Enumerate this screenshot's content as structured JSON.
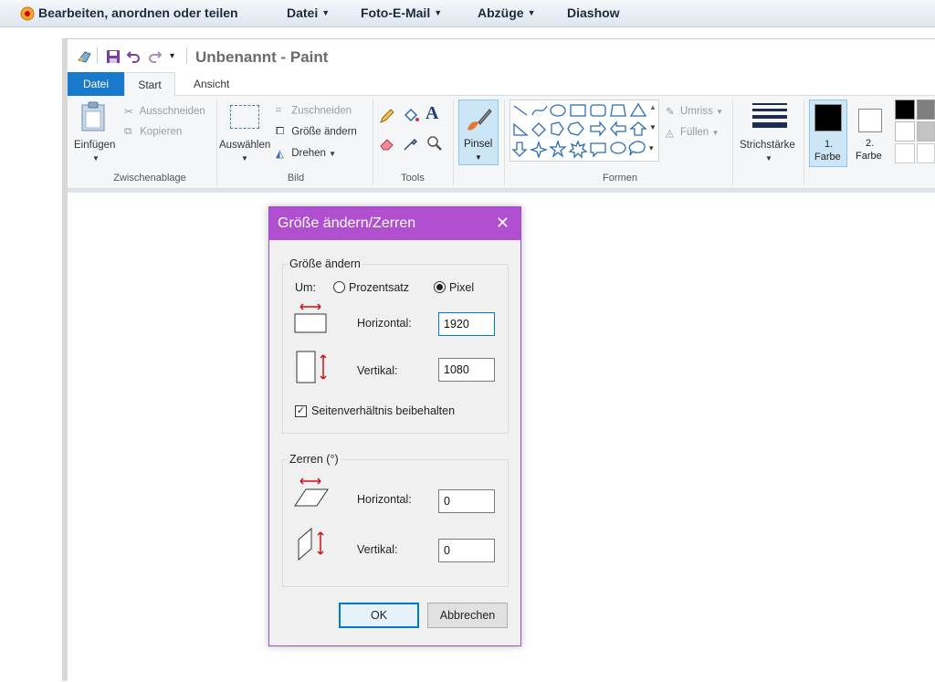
{
  "topbar": {
    "items": [
      {
        "label": "Bearbeiten, anordnen oder teilen",
        "caret": false
      },
      {
        "label": "Datei",
        "caret": true
      },
      {
        "label": "Foto-E-Mail",
        "caret": true
      },
      {
        "label": "Abzüge",
        "caret": true
      },
      {
        "label": "Diashow",
        "caret": false
      }
    ]
  },
  "window": {
    "title": "Unbenannt - Paint"
  },
  "tabs": {
    "file": "Datei",
    "start": "Start",
    "view": "Ansicht"
  },
  "ribbon": {
    "clipboard": {
      "paste": "Einfügen",
      "cut": "Ausschneiden",
      "copy": "Kopieren",
      "label": "Zwischenablage"
    },
    "image": {
      "select": "Auswählen",
      "crop": "Zuschneiden",
      "resize": "Größe ändern",
      "rotate": "Drehen",
      "label": "Bild"
    },
    "tools": {
      "label": "Tools"
    },
    "brush": {
      "label": "Pinsel"
    },
    "shapes": {
      "outline": "Umriss",
      "fill": "Füllen",
      "label": "Formen"
    },
    "stroke": {
      "label": "Strichstärke"
    },
    "colors": {
      "color1_num": "1.",
      "color1_word": "Farbe",
      "color2_num": "2.",
      "color2_word": "Farbe",
      "color1": "#000000",
      "color2": "#ffffff"
    }
  },
  "dialog": {
    "title": "Größe ändern/Zerren",
    "close": "✕",
    "resize": {
      "legend": "Größe ändern",
      "by_label": "Um:",
      "percent": "Prozentsatz",
      "pixel": "Pixel",
      "selected": "pixel",
      "horizontal_label": "Horizontal:",
      "horizontal_value": "1920",
      "vertical_label": "Vertikal:",
      "vertical_value": "1080",
      "keep_ratio": "Seitenverhältnis beibehalten",
      "keep_ratio_checked": true
    },
    "skew": {
      "legend": "Zerren (°)",
      "horizontal_label": "Horizontal:",
      "horizontal_value": "0",
      "vertical_label": "Vertikal:",
      "vertical_value": "0"
    },
    "ok": "OK",
    "cancel": "Abbrechen"
  }
}
